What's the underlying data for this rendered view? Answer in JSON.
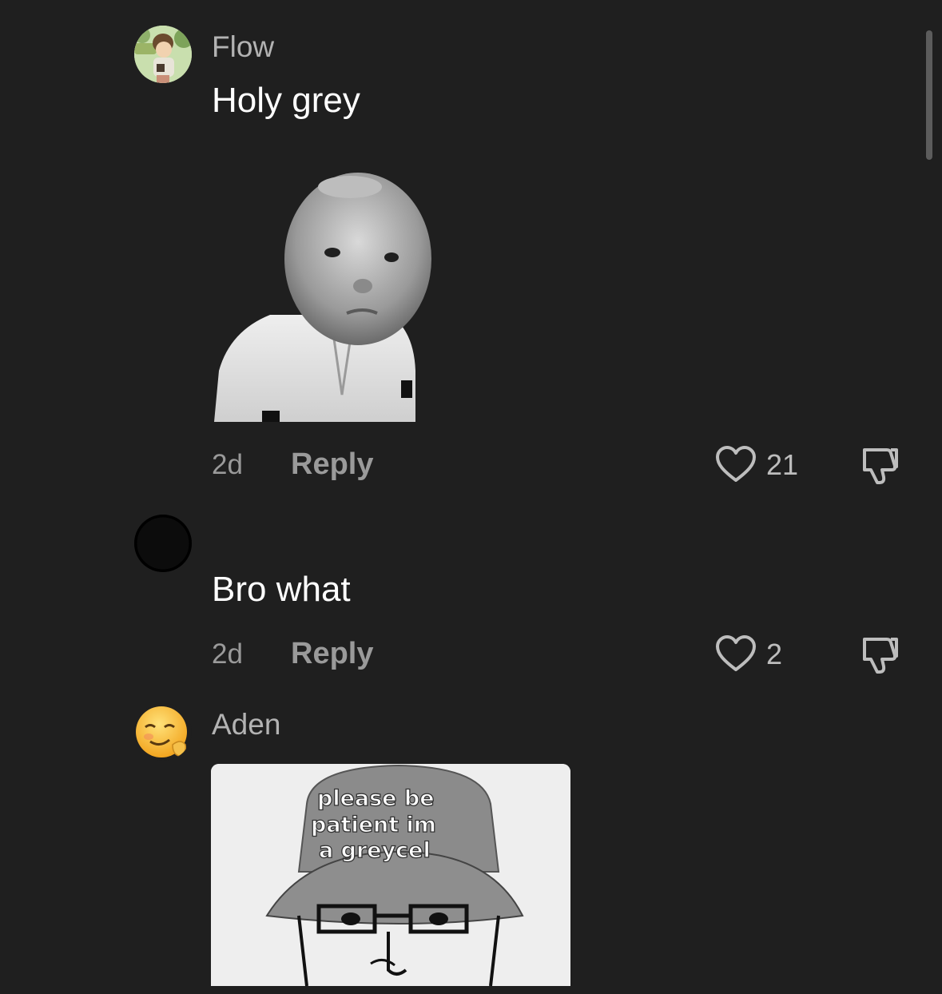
{
  "comments": [
    {
      "username": "Flow",
      "text": "Holy grey",
      "time": "2d",
      "reply_label": "Reply",
      "likes": "21",
      "avatar_icon": "cartoon-character-avatar",
      "attachment": "grey-baby-sticker"
    },
    {
      "username": "",
      "text": "Bro what",
      "time": "2d",
      "reply_label": "Reply",
      "likes": "2",
      "avatar_icon": "black-circle-avatar"
    },
    {
      "username": "Aden",
      "text": "",
      "attachment_caption": "please be patient im a greycel",
      "attachment_lines": [
        "please be",
        "patient im",
        "a greycel"
      ],
      "avatar_icon": "smirking-emoji-avatar",
      "attachment": "greycel-cap-meme"
    }
  ],
  "colors": {
    "background": "#1f1f1f",
    "username": "#b3b3b3",
    "text": "#ffffff",
    "meta": "#9a9a9a"
  }
}
